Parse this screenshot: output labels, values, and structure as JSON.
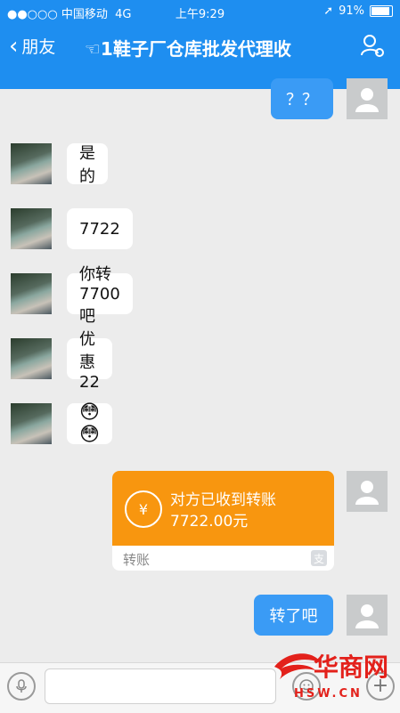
{
  "status": {
    "signal": "●●○○○",
    "carrier": "中国移动",
    "network": "4G",
    "time": "上午9:29",
    "battery": "91%"
  },
  "nav": {
    "back_label": "朋友",
    "title": "☜1鞋子厂仓库批发代理收"
  },
  "messages": [
    {
      "side": "out",
      "text": "？？"
    },
    {
      "side": "in",
      "text": "是的"
    },
    {
      "side": "in",
      "text": "7722"
    },
    {
      "side": "in",
      "text": "你转7700吧"
    },
    {
      "side": "in",
      "text": "优惠22"
    },
    {
      "side": "in",
      "text": "😳😳"
    },
    {
      "side": "out",
      "type": "transfer",
      "status_text": "对方已收到转账",
      "amount": "7722.00元",
      "footer": "转账"
    },
    {
      "side": "out",
      "text": "转了吧"
    }
  ],
  "watermark": {
    "brand": "华商网",
    "url": "HSW.CN"
  },
  "colors": {
    "header": "#1e8ef0",
    "out_bubble": "#3a9bf5",
    "transfer": "#f8960f",
    "background": "#ececec"
  }
}
